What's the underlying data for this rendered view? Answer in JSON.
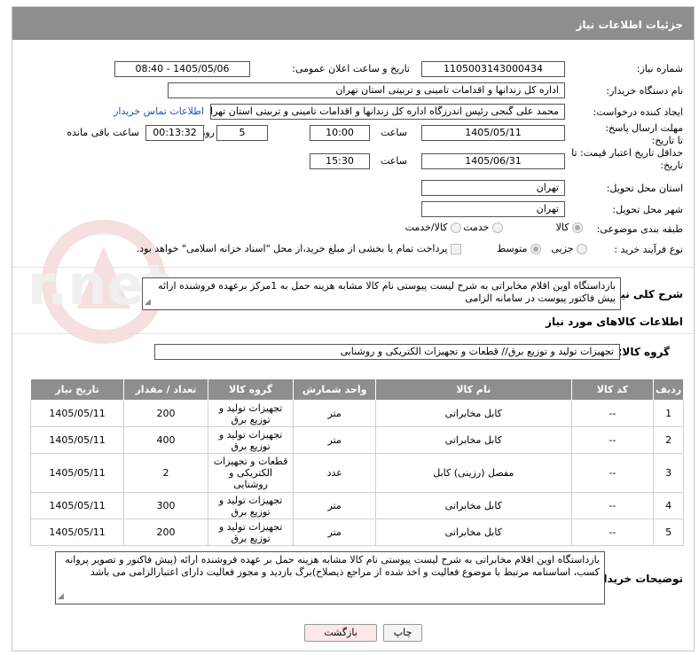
{
  "header": {
    "title": "جزئیات اطلاعات نیاز"
  },
  "form": {
    "need_number_label": "شماره نیاز:",
    "need_number": "1105003143000434",
    "announce_label": "تاریخ و ساعت اعلان عمومی:",
    "announce_value": "1405/05/06 - 08:40",
    "buyer_org_label": "نام دستگاه خریدار:",
    "buyer_org": "اداره کل زندانها و اقدامات تامینی و تربیتی استان تهران",
    "creator_label": "ایجاد کننده درخواست:",
    "creator": "محمد علی گنجی رئیس اندرزگاه  اداره کل زندانها و اقدامات تامینی و تربیتی استان تهران",
    "contact_link": "اطلاعات تماس خریدار",
    "deadline_label": "مهلت ارسال پاسخ: تا تاریخ:",
    "deadline_date": "1405/05/11",
    "time_label": "ساعت",
    "deadline_time": "10:00",
    "days_value": "5",
    "days_label": "روز و",
    "remaining_time": "00:13:32",
    "remaining_label": "ساعت باقی مانده",
    "price_validity_label": "حداقل تاریخ اعتبار قیمت: تا تاریخ:",
    "price_validity_date": "1405/06/31",
    "price_validity_time": "15:30",
    "province_label": "استان محل تحویل:",
    "province": "تهران",
    "city_label": "شهر محل تحویل:",
    "city": "تهران",
    "category_label": "طبقه بندی موضوعی:",
    "category_options": [
      "کالا",
      "خدمت",
      "کالا/خدمت"
    ],
    "process_label": "نوع فرآیند خرید :",
    "process_options": [
      "جزیی",
      "متوسط"
    ],
    "payment_note": "پرداخت تمام یا بخشی از مبلغ خرید،از محل \"اسناد خزانه اسلامی\" خواهد بود."
  },
  "description": {
    "label": "شرح کلی نیاز:",
    "text": "بازداستگاه اوین اقلام مخابراتی به شرح لیست پیوستی نام کالا مشابه هزینه حمل به 1مرکز برعهده فروشنده ارائه پیش فاکتور  پیوست در سامانه الزامی"
  },
  "goods": {
    "section_title": "اطلاعات کالاهای مورد نیاز",
    "group_label": "گروه کالا:",
    "group_value": "تجهیزات تولید و توزیع برق// قطعات و تجهیزات الکتریکی و روشنایی",
    "columns": [
      "ردیف",
      "کد کالا",
      "نام کالا",
      "واحد شمارش",
      "گروه کالا",
      "تعداد / مقدار",
      "تاریخ نیاز"
    ],
    "rows": [
      {
        "row": "1",
        "code": "--",
        "name": "کابل مخابراتی",
        "unit": "متر",
        "group": "تجهیزات تولید و توزیع برق",
        "qty": "200",
        "date": "1405/05/11"
      },
      {
        "row": "2",
        "code": "--",
        "name": "کابل مخابراتی",
        "unit": "متر",
        "group": "تجهیزات تولید و توزیع برق",
        "qty": "400",
        "date": "1405/05/11"
      },
      {
        "row": "3",
        "code": "--",
        "name": "مفصل (رزینی) کابل",
        "unit": "عدد",
        "group": "قطعات و تجهیزات الکتریکی و روشنایی",
        "qty": "2",
        "date": "1405/05/11"
      },
      {
        "row": "4",
        "code": "--",
        "name": "کابل مخابراتی",
        "unit": "متر",
        "group": "تجهیزات تولید و توزیع برق",
        "qty": "300",
        "date": "1405/05/11"
      },
      {
        "row": "5",
        "code": "--",
        "name": "کابل مخابراتی",
        "unit": "متر",
        "group": "تجهیزات تولید و توزیع برق",
        "qty": "200",
        "date": "1405/05/11"
      }
    ]
  },
  "buyer_notes": {
    "label": "توضیحات خریدار:",
    "text": "بازداستگاه اوین اقلام مخابراتی به شرح لیست پیوستی نام کالا مشابه هزینه حمل بر عهده فروشنده ارائه (پیش فاکتور و تصویر پروانه کسب، اساسنامه مرتبط با موضوع فعالیت و اخذ شده از مراجع ذیصلاح)برگ بازدید و مجوز فعالیت دارای اعتبارالزامی می باشد"
  },
  "buttons": {
    "print": "چاپ",
    "back": "بازگشت"
  },
  "watermark": {
    "text": "AriaTender.net"
  },
  "colors": {
    "header_bg": "#8d8f8c",
    "link": "#1a55b0",
    "back_bg": "#fde8e8"
  }
}
